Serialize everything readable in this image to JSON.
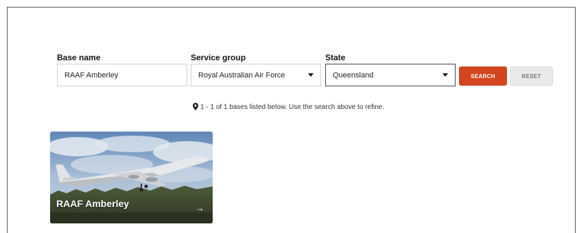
{
  "filters": {
    "base_name": {
      "label": "Base name",
      "value": "RAAF Amberley"
    },
    "service_group": {
      "label": "Service group",
      "value": "Royal Australian Air Force"
    },
    "state": {
      "label": "State",
      "value": "Queensland"
    },
    "search_label": "SEARCH",
    "reset_label": "RESET"
  },
  "status_text": "1 - 1 of 1 bases listed below. Use the search above to refine.",
  "results": [
    {
      "title": "RAAF Amberley",
      "arrow": "→"
    }
  ],
  "icons": {
    "status": "map-marker-icon",
    "card_arrow": "arrow-right-icon",
    "caret": "caret-down-icon"
  },
  "colors": {
    "accent": "#d2461f",
    "reset_bg": "#e9e9e9"
  }
}
